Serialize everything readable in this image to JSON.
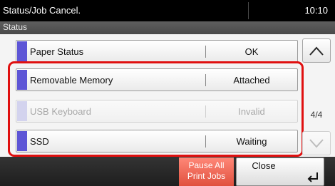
{
  "title_bar": {
    "title": "Status/Job Cancel.",
    "clock": "10:10"
  },
  "status_bar": {
    "label": "Status"
  },
  "device_rows": [
    {
      "name": "Paper Status",
      "value": "OK",
      "enabled": true
    },
    {
      "name": "Removable Memory",
      "value": "Attached",
      "enabled": true
    },
    {
      "name": "USB Keyboard",
      "value": "Invalid",
      "enabled": false
    },
    {
      "name": "SSD",
      "value": "Waiting",
      "enabled": true
    }
  ],
  "pagination": {
    "indicator": "4/4",
    "scroll_up_icon": "chevron-up-icon",
    "scroll_down_icon": "chevron-down-icon",
    "scroll_down_enabled": false
  },
  "bottom_bar": {
    "pause_line1": "Pause All",
    "pause_line2": "Print Jobs",
    "close_label": "Close",
    "close_icon": "enter-return-icon"
  },
  "colors": {
    "accent_marker": "#5d55d6",
    "highlight_frame": "#e01010",
    "pause_button": "#e0503e"
  }
}
